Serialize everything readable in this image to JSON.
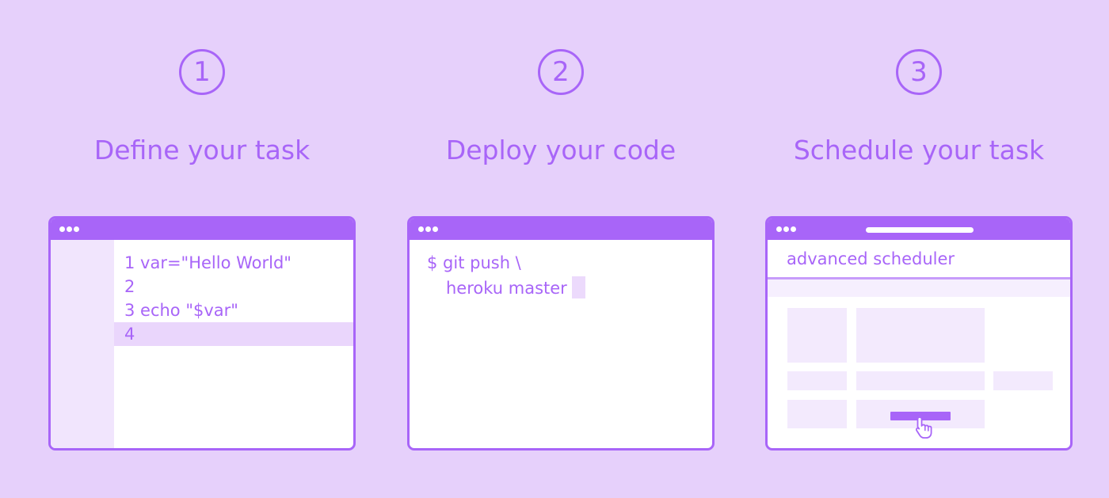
{
  "steps": [
    {
      "number": "1",
      "title": "Define your task"
    },
    {
      "number": "2",
      "title": "Deploy your code"
    },
    {
      "number": "3",
      "title": "Schedule your task"
    }
  ],
  "editor": {
    "lines": [
      "1 var=\"Hello World\"",
      "2",
      "3 echo \"$var\"",
      "4"
    ],
    "active_line": 4
  },
  "terminal": {
    "lines": [
      "$ git push \\",
      "heroku master"
    ]
  },
  "scheduler": {
    "title": "advanced scheduler"
  },
  "icons": {
    "window_dots": "window-dots-icon",
    "pointer": "hand-pointer-icon"
  },
  "colors": {
    "background": "#e6d0fb",
    "accent": "#a865f8",
    "window": "#ffffff",
    "highlight": "#ead6fc"
  }
}
